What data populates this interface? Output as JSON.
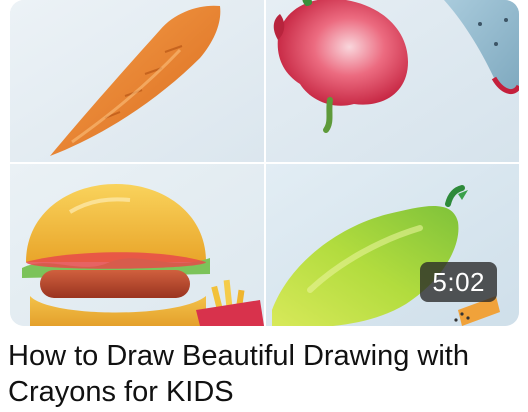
{
  "video": {
    "title": "How to Draw Beautiful Drawing with Crayons for KIDS",
    "duration": "5:02",
    "thumbnail": {
      "panels": [
        "carrot",
        "dragon-fruit",
        "watermelon",
        "burger",
        "french-fries",
        "papaya"
      ],
      "colors": {
        "background": "#dfe9ef",
        "divider": "#ffffff",
        "carrot": "#e9862e",
        "dragon_fruit": "#d8324c",
        "burger_bun": "#f2b93a",
        "sausage": "#b9462c",
        "papaya": "#a8d83a",
        "stem": "#3a8f3a"
      }
    }
  }
}
